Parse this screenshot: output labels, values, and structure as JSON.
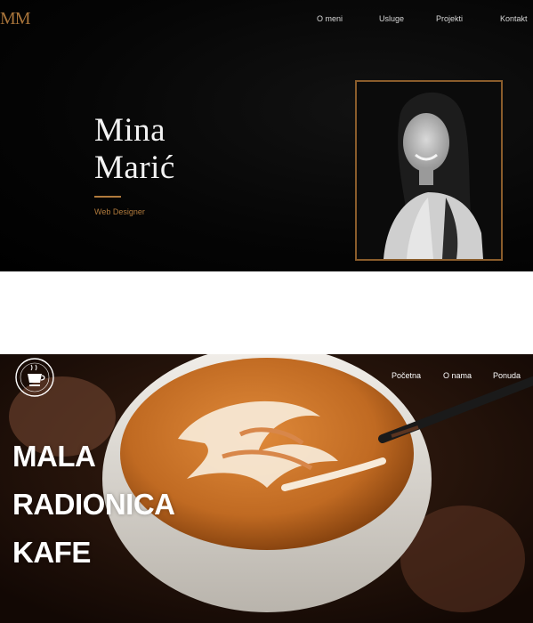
{
  "portfolio": {
    "logo": "MM",
    "nav": [
      "O meni",
      "Usluge",
      "Projekti",
      "Kontakt"
    ],
    "name_line1": "Mina",
    "name_line2": "Marić",
    "role": "Web Designer",
    "colors": {
      "accent": "#b07a3c",
      "background": "#000000"
    }
  },
  "cafe": {
    "nav": [
      "Početna",
      "O nama",
      "Ponuda"
    ],
    "title_line1": "MALA",
    "title_line2": "RADIONICA",
    "title_line3": "KAFE",
    "logo_icon": "cafe-badge-icon",
    "colors": {
      "latte": "#c8742a",
      "cup": "#e9e6e1",
      "text": "#ffffff"
    }
  }
}
